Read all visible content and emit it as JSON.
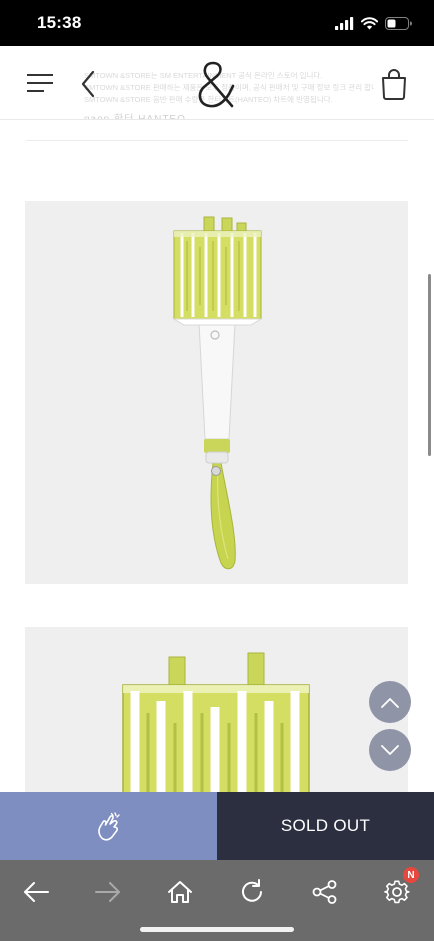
{
  "status_bar": {
    "time": "15:38"
  },
  "header": {
    "notice_lines": [
      "SMTOWN &STORE는 SM ENTERTAINMENT 공식 온라인 스토어 입니다.",
      "SMTOWN &STORE 판매하는 제품은 모두 정품이며, 공식 판매처 및 구매 정보 링크 관리 합니다.",
      "SMTOWN &STORE 음반 판매 수량은 한터차트(HANTEO) 차트에 반영됩니다."
    ],
    "faded_brand": "gaon  한터 HANTEO"
  },
  "product_images": [
    {
      "name": "lightstick-full"
    },
    {
      "name": "lightstick-detail"
    }
  ],
  "action_bar": {
    "soldout_label": "SOLD OUT"
  },
  "colors": {
    "like_bg": "#7f8ec0",
    "soldout_bg": "#2c2f40",
    "lightstick_accent": "#c9d65a",
    "toolbar_bg": "#6b6b6b",
    "badge": "#e8473d"
  },
  "browser_toolbar": {
    "icons": [
      "back-arrow-icon",
      "forward-arrow-icon",
      "home-icon",
      "refresh-icon",
      "share-icon",
      "gear-icon"
    ],
    "badge_text": "N"
  }
}
